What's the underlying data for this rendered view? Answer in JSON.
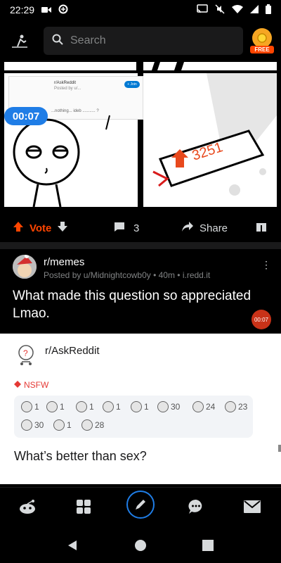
{
  "status": {
    "time": "22:29"
  },
  "search": {
    "placeholder": "Search"
  },
  "coin": {
    "label": "FREE"
  },
  "post1": {
    "mini_card": {
      "sub": "r/AskReddit",
      "posted": "Posted by u/...",
      "join": "+ Join",
      "line": "...nothing... ideb ........... ?"
    },
    "video_timer": "00:07",
    "counter_number": "3251",
    "vote_label": "Vote",
    "comment_count": "3",
    "share_label": "Share"
  },
  "post2": {
    "subreddit": "r/memes",
    "posted_by": "Posted by u/Midnightcowb0y • 40m • i.redd.it",
    "title": "What made this question so appreciated Lmao.",
    "video_badge": "00:07"
  },
  "card": {
    "subreddit": "r/AskReddit",
    "nsfw": "NSFW",
    "awards": [
      "1",
      "1",
      "1",
      "1",
      "1",
      "30",
      "24",
      "23",
      "30",
      "1",
      "28"
    ],
    "title": "What’s better than sex?"
  },
  "colors": {
    "accent": "#ff4500",
    "timer": "#1f7de6",
    "background": "#000000"
  }
}
